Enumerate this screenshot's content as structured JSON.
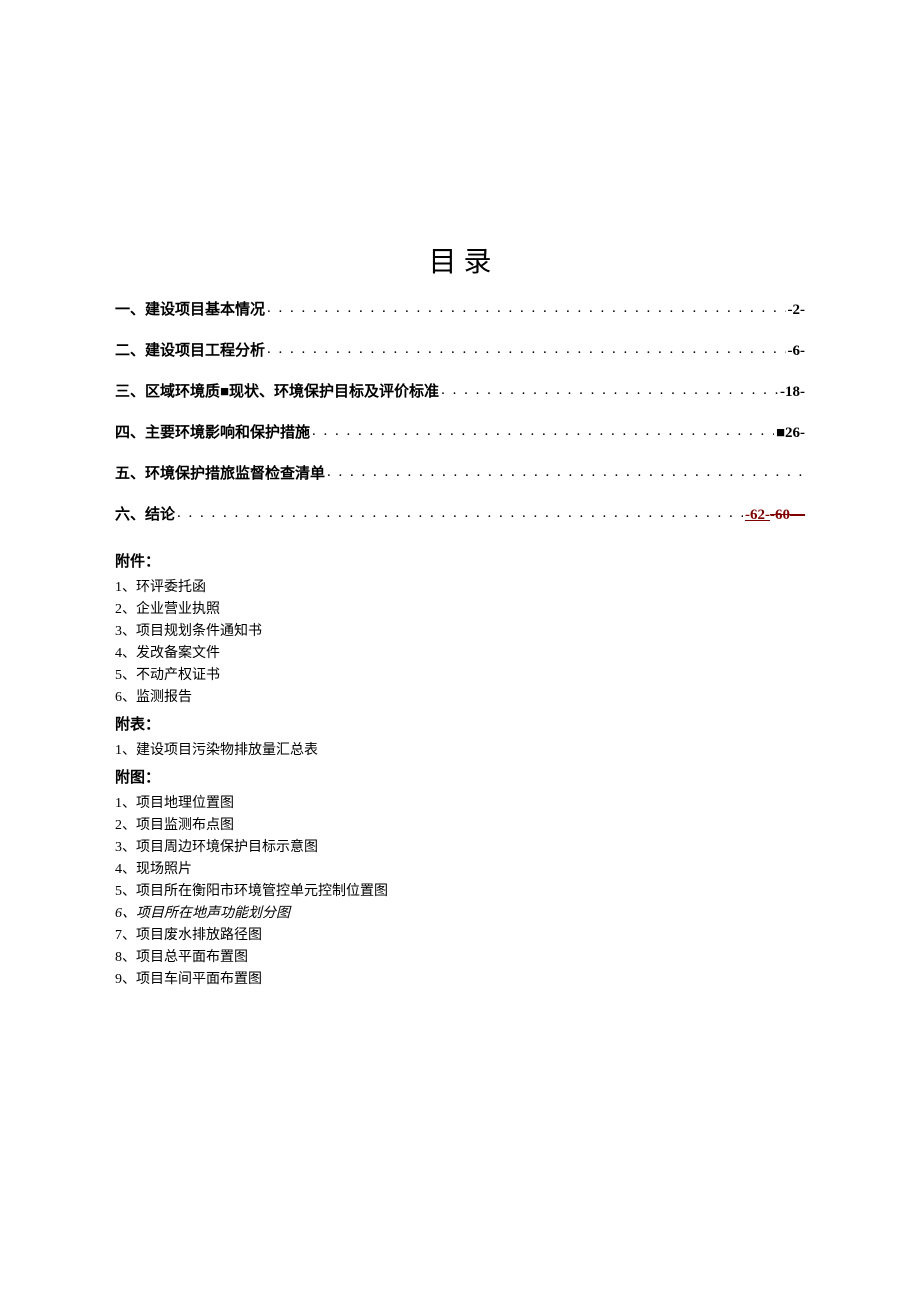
{
  "title": "目 录",
  "toc": [
    {
      "label": "一、建设项目基本情况",
      "page": "-2-"
    },
    {
      "label": "二、建设项目工程分析",
      "page": "-6-"
    },
    {
      "label": "三、区域环境质■现状、环境保护目标及评价标准",
      "page": "-18-"
    },
    {
      "label": "四、主要环境影响和保护措施",
      "page": "■26-"
    },
    {
      "label": "五、环境保护措旅监督检查清单",
      "page": ""
    },
    {
      "label": "六、结论",
      "page_parts": {
        "underline": "-62-",
        "strike": "-60—"
      }
    }
  ],
  "fujian_title": "附件：",
  "fujian": [
    "1、环评委托函",
    "2、企业营业执照",
    "3、项目规划条件通知书",
    "4、发改备案文件",
    "5、不动产权证书",
    "6、监测报告"
  ],
  "fubiao_title": "附表：",
  "fubiao": [
    "1、建设项目污染物排放量汇总表"
  ],
  "futu_title": "附图：",
  "futu": [
    "1、项目地理位置图",
    "2、项目监测布点图",
    "3、项目周边环境保护目标示意图",
    "4、现场照片",
    "5、项目所在衡阳市环境管控单元控制位置图",
    "6、项目所在地声功能划分图",
    "7、项目废水排放路径图",
    "8、项目总平面布置图",
    "9、项目车间平面布置图"
  ],
  "dots": ". . . . . . . . . . . . . . . . . . . . . . . . . . . . . . . . . . . . . . . . . . . . . . . . . . . . . . . . . . . . . . . . . . . . . . . . . . . . . . . . . . . . . . . . . . . . . . ."
}
